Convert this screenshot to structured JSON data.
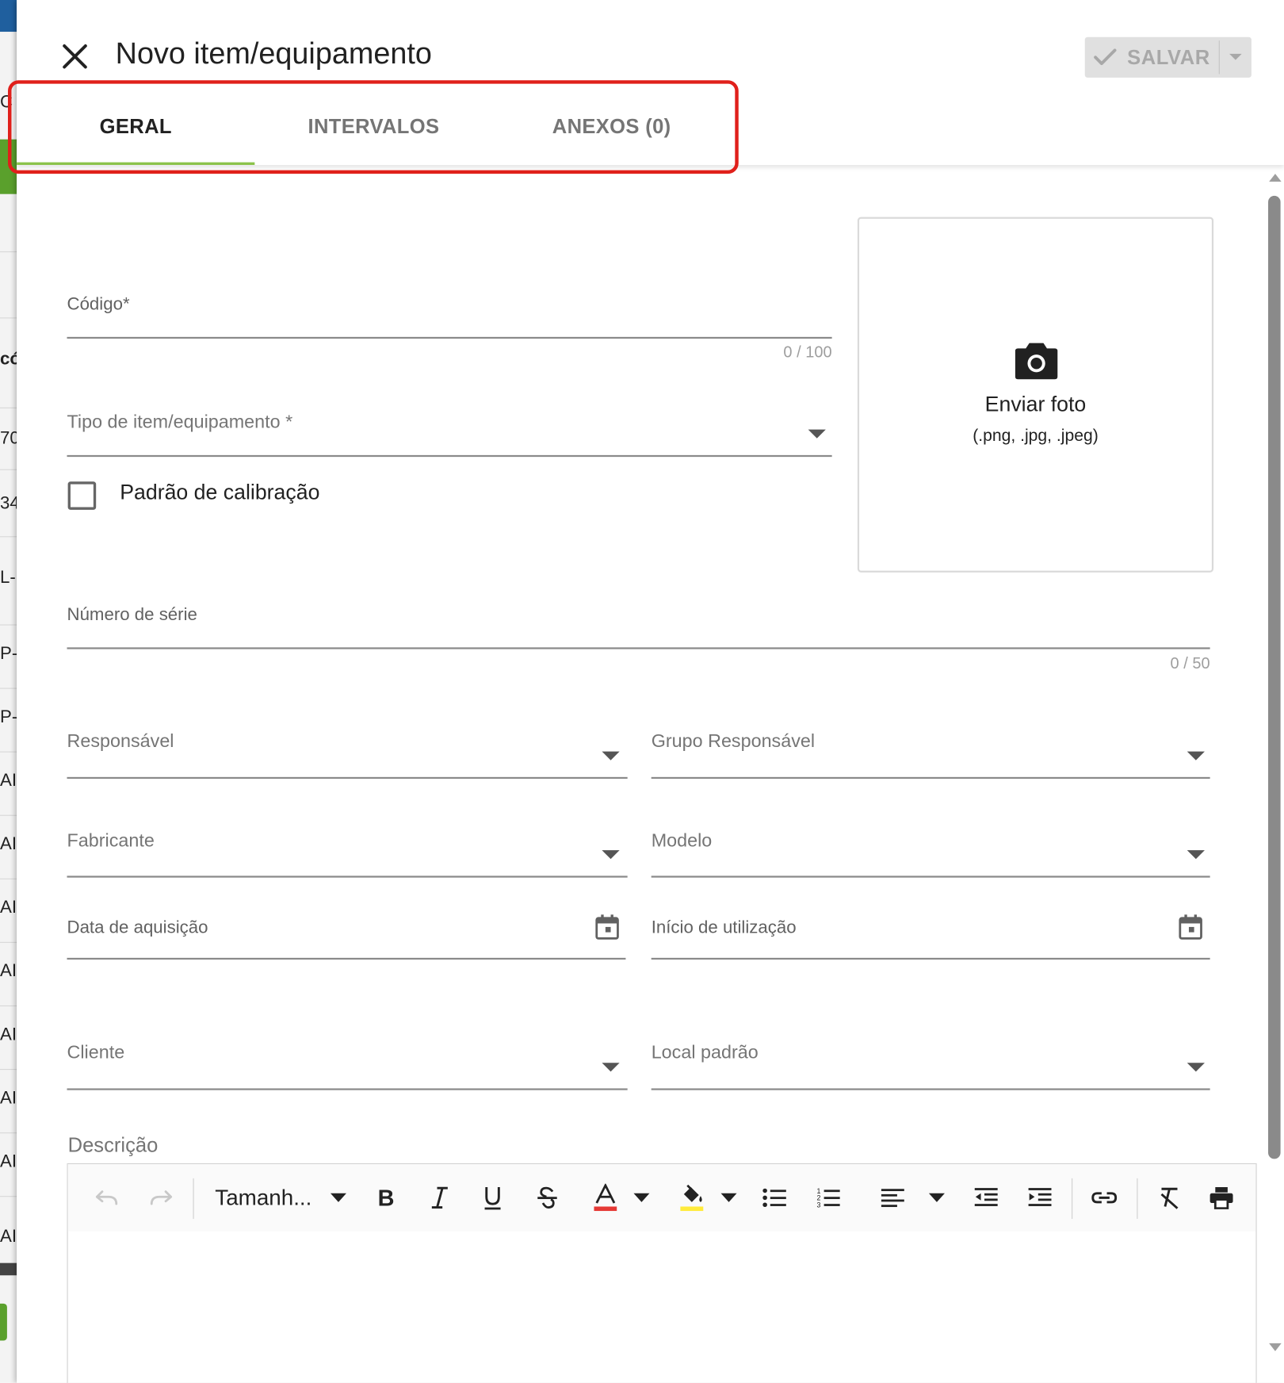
{
  "background": {
    "rows": [
      "C",
      "có",
      "70",
      "34",
      "L-",
      "P-",
      "P-",
      "AI",
      "AI",
      "AI",
      "AI",
      "AI",
      "AI",
      "AI",
      "AI"
    ]
  },
  "dialog": {
    "title": "Novo item/equipamento",
    "save_label": "SALVAR",
    "tabs": [
      "GERAL",
      "INTERVALOS",
      "ANEXOS (0)"
    ],
    "active_tab": "GERAL",
    "highlight_color": "#e0201b",
    "accent_color": "#8bc34a"
  },
  "form": {
    "codigo": {
      "label": "Código*",
      "counter": "0 / 100",
      "value": ""
    },
    "tipo": {
      "label": "Tipo de item/equipamento *",
      "value": ""
    },
    "padrao": {
      "label": "Padrão de calibração",
      "checked": false
    },
    "photo": {
      "title": "Enviar foto",
      "formats": "(.png, .jpg, .jpeg)"
    },
    "numero_serie": {
      "label": "Número de série",
      "counter": "0 / 50",
      "value": ""
    },
    "responsavel": {
      "label": "Responsável",
      "value": ""
    },
    "grupo_responsavel": {
      "label": "Grupo Responsável",
      "value": ""
    },
    "fabricante": {
      "label": "Fabricante",
      "value": ""
    },
    "modelo": {
      "label": "Modelo",
      "value": ""
    },
    "data_aquisicao": {
      "label": "Data de aquisição",
      "value": ""
    },
    "inicio_utilizacao": {
      "label": "Início de utilização",
      "value": ""
    },
    "cliente": {
      "label": "Cliente",
      "value": ""
    },
    "local_padrao": {
      "label": "Local padrão",
      "value": ""
    },
    "descricao": {
      "label": "Descrição",
      "value": ""
    }
  },
  "editor": {
    "font_size_label": "Tamanh...",
    "text_color_indicator": "#e53935",
    "highlight_color_indicator": "#ffeb3b"
  }
}
